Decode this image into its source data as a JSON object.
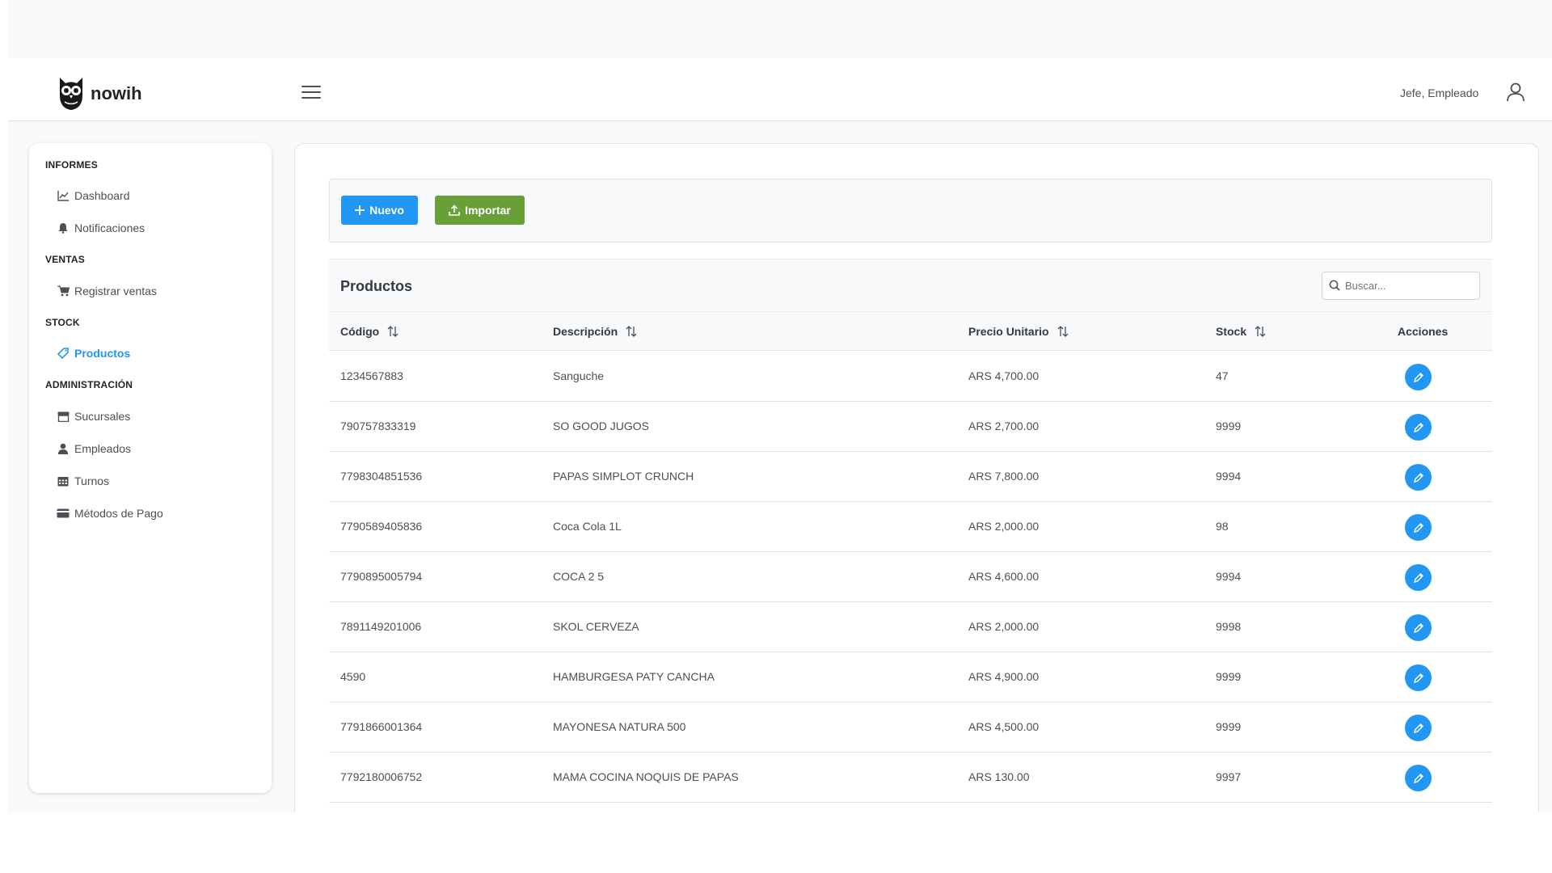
{
  "header": {
    "brand": "nowih",
    "user_label": "Jefe, Empleado"
  },
  "sidebar": {
    "sections": [
      {
        "title": "INFORMES",
        "items": [
          {
            "label": "Dashboard",
            "icon": "chart-line-icon"
          },
          {
            "label": "Notificaciones",
            "icon": "bell-icon"
          }
        ]
      },
      {
        "title": "VENTAS",
        "items": [
          {
            "label": "Registrar ventas",
            "icon": "cart-icon"
          }
        ]
      },
      {
        "title": "STOCK",
        "items": [
          {
            "label": "Productos",
            "icon": "tag-icon",
            "active": true
          }
        ]
      },
      {
        "title": "ADMINISTRACIÓN",
        "items": [
          {
            "label": "Sucursales",
            "icon": "store-icon"
          },
          {
            "label": "Empleados",
            "icon": "user-icon"
          },
          {
            "label": "Turnos",
            "icon": "calendar-icon"
          },
          {
            "label": "Métodos de Pago",
            "icon": "credit-card-icon"
          }
        ]
      }
    ]
  },
  "toolbar": {
    "new_label": "Nuevo",
    "import_label": "Importar"
  },
  "table": {
    "title": "Productos",
    "search_placeholder": "Buscar...",
    "columns": [
      "Código",
      "Descripción",
      "Precio Unitario",
      "Stock",
      "Acciones"
    ],
    "rows": [
      {
        "codigo": "1234567883",
        "descripcion": "Sanguche",
        "precio": "ARS 4,700.00",
        "stock": "47"
      },
      {
        "codigo": "790757833319",
        "descripcion": "SO GOOD JUGOS",
        "precio": "ARS 2,700.00",
        "stock": "9999"
      },
      {
        "codigo": "7798304851536",
        "descripcion": "PAPAS SIMPLOT CRUNCH",
        "precio": "ARS 7,800.00",
        "stock": "9994"
      },
      {
        "codigo": "7790589405836",
        "descripcion": "Coca Cola 1L",
        "precio": "ARS 2,000.00",
        "stock": "98"
      },
      {
        "codigo": "7790895005794",
        "descripcion": "COCA 2 5",
        "precio": "ARS 4,600.00",
        "stock": "9994"
      },
      {
        "codigo": "7891149201006",
        "descripcion": "SKOL CERVEZA",
        "precio": "ARS 2,000.00",
        "stock": "9998"
      },
      {
        "codigo": "4590",
        "descripcion": "HAMBURGESA PATY CANCHA",
        "precio": "ARS 4,900.00",
        "stock": "9999"
      },
      {
        "codigo": "7791866001364",
        "descripcion": "MAYONESA NATURA 500",
        "precio": "ARS 4,500.00",
        "stock": "9999"
      },
      {
        "codigo": "7792180006752",
        "descripcion": "MAMA COCINA NOQUIS DE PAPAS",
        "precio": "ARS 130.00",
        "stock": "9997"
      }
    ]
  },
  "colors": {
    "primary": "#2196f3",
    "success": "#689f38"
  }
}
